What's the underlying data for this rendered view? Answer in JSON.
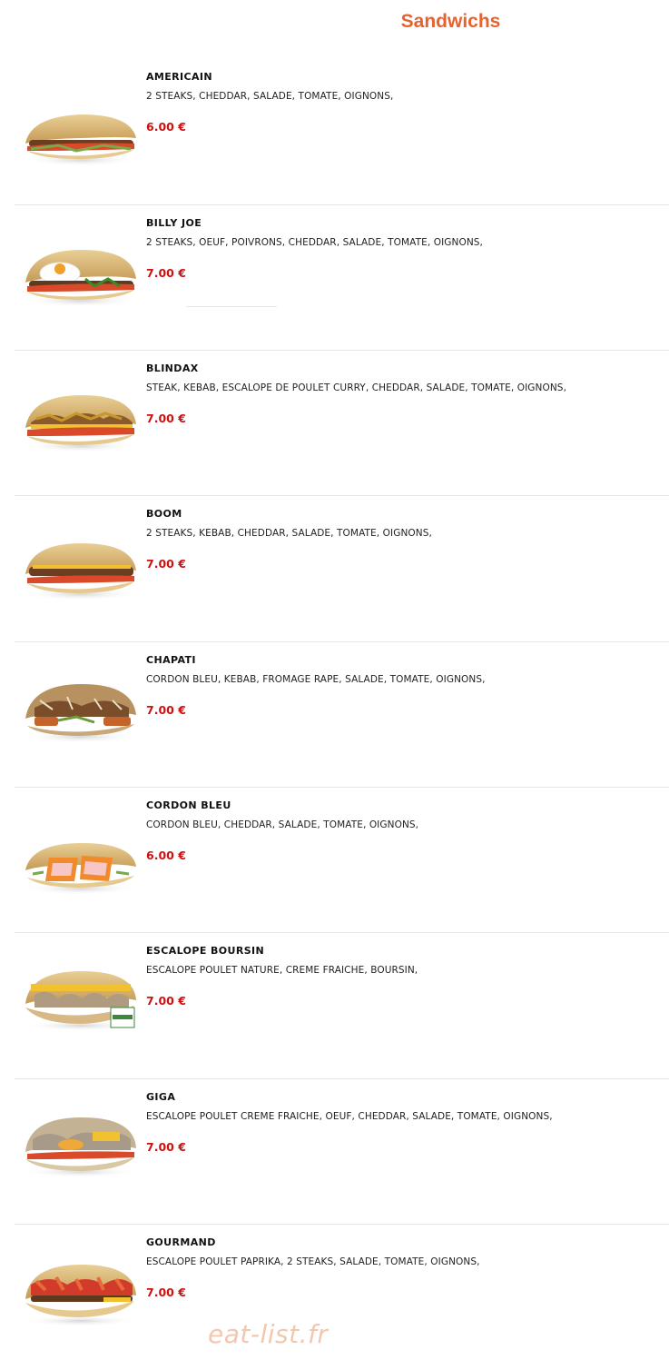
{
  "page": {
    "title": "Sandwichs"
  },
  "items": [
    {
      "name": "AMERICAIN",
      "description": "2 STEAKS, CHEDDAR, SALADE, TOMATE, OIGNONS,",
      "price": "6.00 €"
    },
    {
      "name": "BILLY JOE",
      "description": "2 STEAKS, OEUF, POIVRONS, CHEDDAR, SALADE, TOMATE, OIGNONS,",
      "price": "7.00 €"
    },
    {
      "name": "BLINDAX",
      "description": "STEAK, KEBAB, ESCALOPE DE POULET CURRY, CHEDDAR, SALADE, TOMATE, OIGNONS,",
      "price": "7.00 €"
    },
    {
      "name": "BOOM",
      "description": "2 STEAKS, KEBAB, CHEDDAR, SALADE, TOMATE, OIGNONS,",
      "price": "7.00 €"
    },
    {
      "name": "CHAPATI",
      "description": "CORDON BLEU, KEBAB, FROMAGE RAPE, SALADE, TOMATE, OIGNONS,",
      "price": "7.00 €"
    },
    {
      "name": "CORDON BLEU",
      "description": "CORDON BLEU, CHEDDAR, SALADE, TOMATE, OIGNONS,",
      "price": "6.00 €"
    },
    {
      "name": "ESCALOPE BOURSIN",
      "description": "ESCALOPE POULET NATURE, CREME FRAICHE, BOURSIN,",
      "price": "7.00 €"
    },
    {
      "name": "GIGA",
      "description": "ESCALOPE POULET CREME FRAICHE, OEUF, CHEDDAR, SALADE, TOMATE, OIGNONS,",
      "price": "7.00 €"
    },
    {
      "name": "GOURMAND",
      "description": "ESCALOPE POULET PAPRIKA, 2 STEAKS, SALADE, TOMATE, OIGNONS,",
      "price": "7.00 €"
    }
  ],
  "watermark": "eat-list.fr"
}
